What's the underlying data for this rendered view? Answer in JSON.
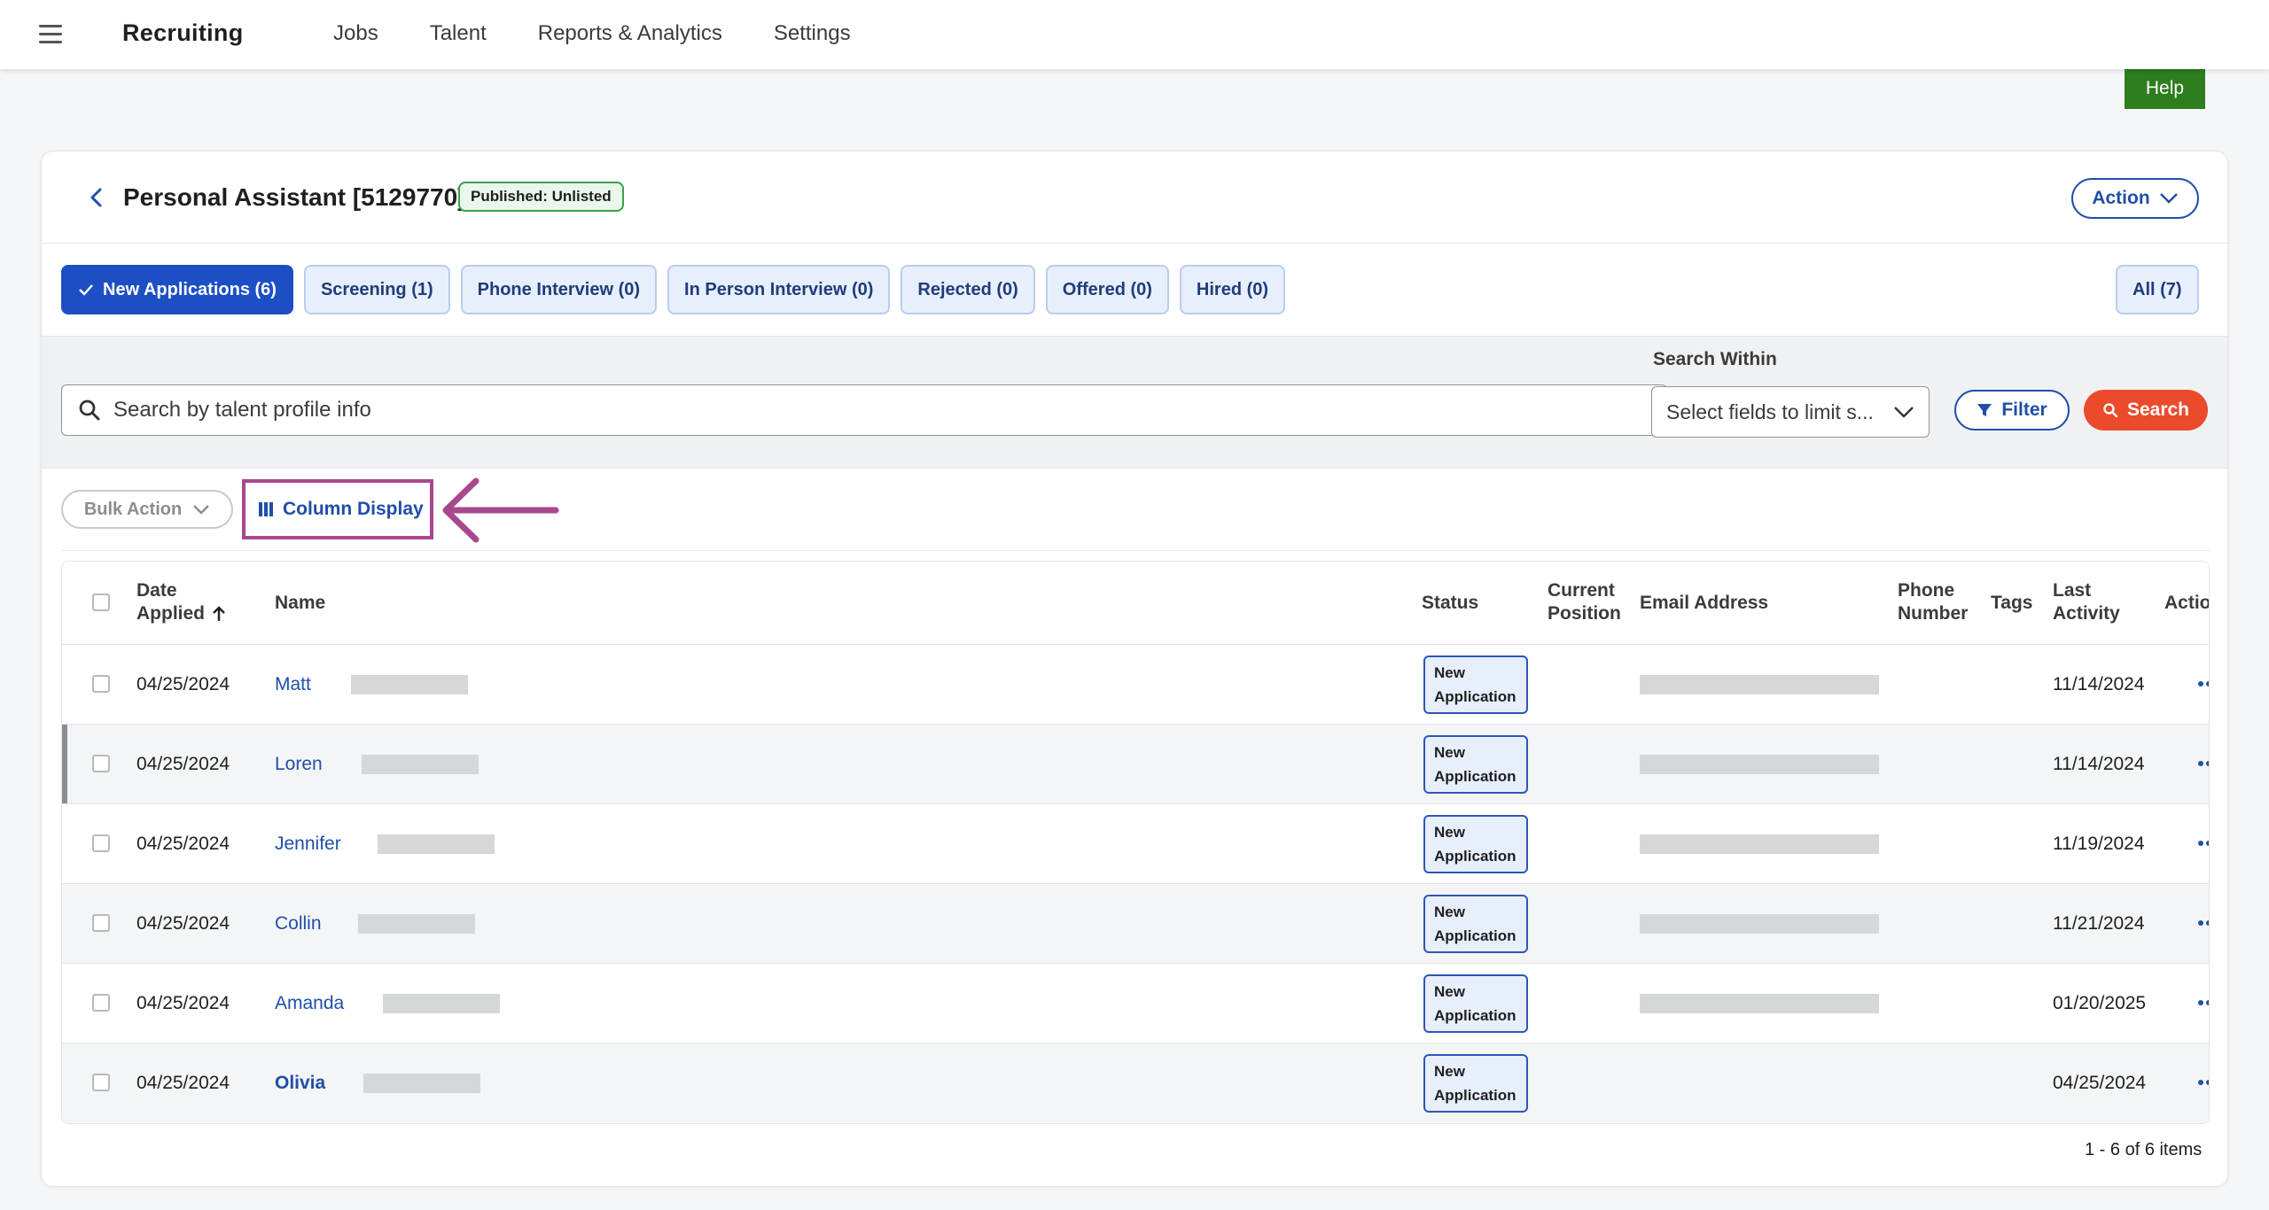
{
  "app": {
    "title": "Recruiting",
    "nav": [
      "Jobs",
      "Talent",
      "Reports & Analytics",
      "Settings"
    ]
  },
  "help_label": "Help",
  "job": {
    "title": "Personal Assistant [5129770]",
    "published_badge": "Published: Unlisted",
    "action_label": "Action"
  },
  "tabs": [
    {
      "label": "New Applications (6)",
      "active": true
    },
    {
      "label": "Screening (1)"
    },
    {
      "label": "Phone Interview (0)"
    },
    {
      "label": "In Person Interview (0)"
    },
    {
      "label": "Rejected (0)"
    },
    {
      "label": "Offered (0)"
    },
    {
      "label": "Hired (0)"
    }
  ],
  "tab_all": "All (7)",
  "search": {
    "placeholder": "Search by talent profile info",
    "within_label": "Search Within",
    "within_placeholder": "Select fields to limit s...",
    "filter_label": "Filter",
    "search_label": "Search"
  },
  "toolbar": {
    "bulk_action": "Bulk Action",
    "column_display": "Column Display"
  },
  "table": {
    "headers": {
      "date_applied_1": "Date",
      "date_applied_2": "Applied",
      "name": "Name",
      "status": "Status",
      "current_position_1": "Current",
      "current_position_2": "Position",
      "email": "Email Address",
      "phone_1": "Phone",
      "phone_2": "Number",
      "tags": "Tags",
      "last_activity_1": "Last",
      "last_activity_2": "Activity",
      "actions": "Actions"
    },
    "status_line1": "New",
    "status_line2": "Application",
    "rows": [
      {
        "date": "04/25/2024",
        "name": "Matt",
        "last_activity": "11/14/2024"
      },
      {
        "date": "04/25/2024",
        "name": "Loren",
        "last_activity": "11/14/2024"
      },
      {
        "date": "04/25/2024",
        "name": "Jennifer",
        "last_activity": "11/19/2024"
      },
      {
        "date": "04/25/2024",
        "name": "Collin",
        "last_activity": "11/21/2024"
      },
      {
        "date": "04/25/2024",
        "name": "Amanda",
        "last_activity": "01/20/2025"
      },
      {
        "date": "04/25/2024",
        "name": "Olivia",
        "last_activity": "04/25/2024"
      }
    ]
  },
  "pagination": "1 - 6 of 6 items",
  "colors": {
    "primary": "#1d4fc4",
    "help_green": "#2e7d1f",
    "search_red": "#ea4b2b",
    "highlight_magenta": "#a8478e"
  }
}
